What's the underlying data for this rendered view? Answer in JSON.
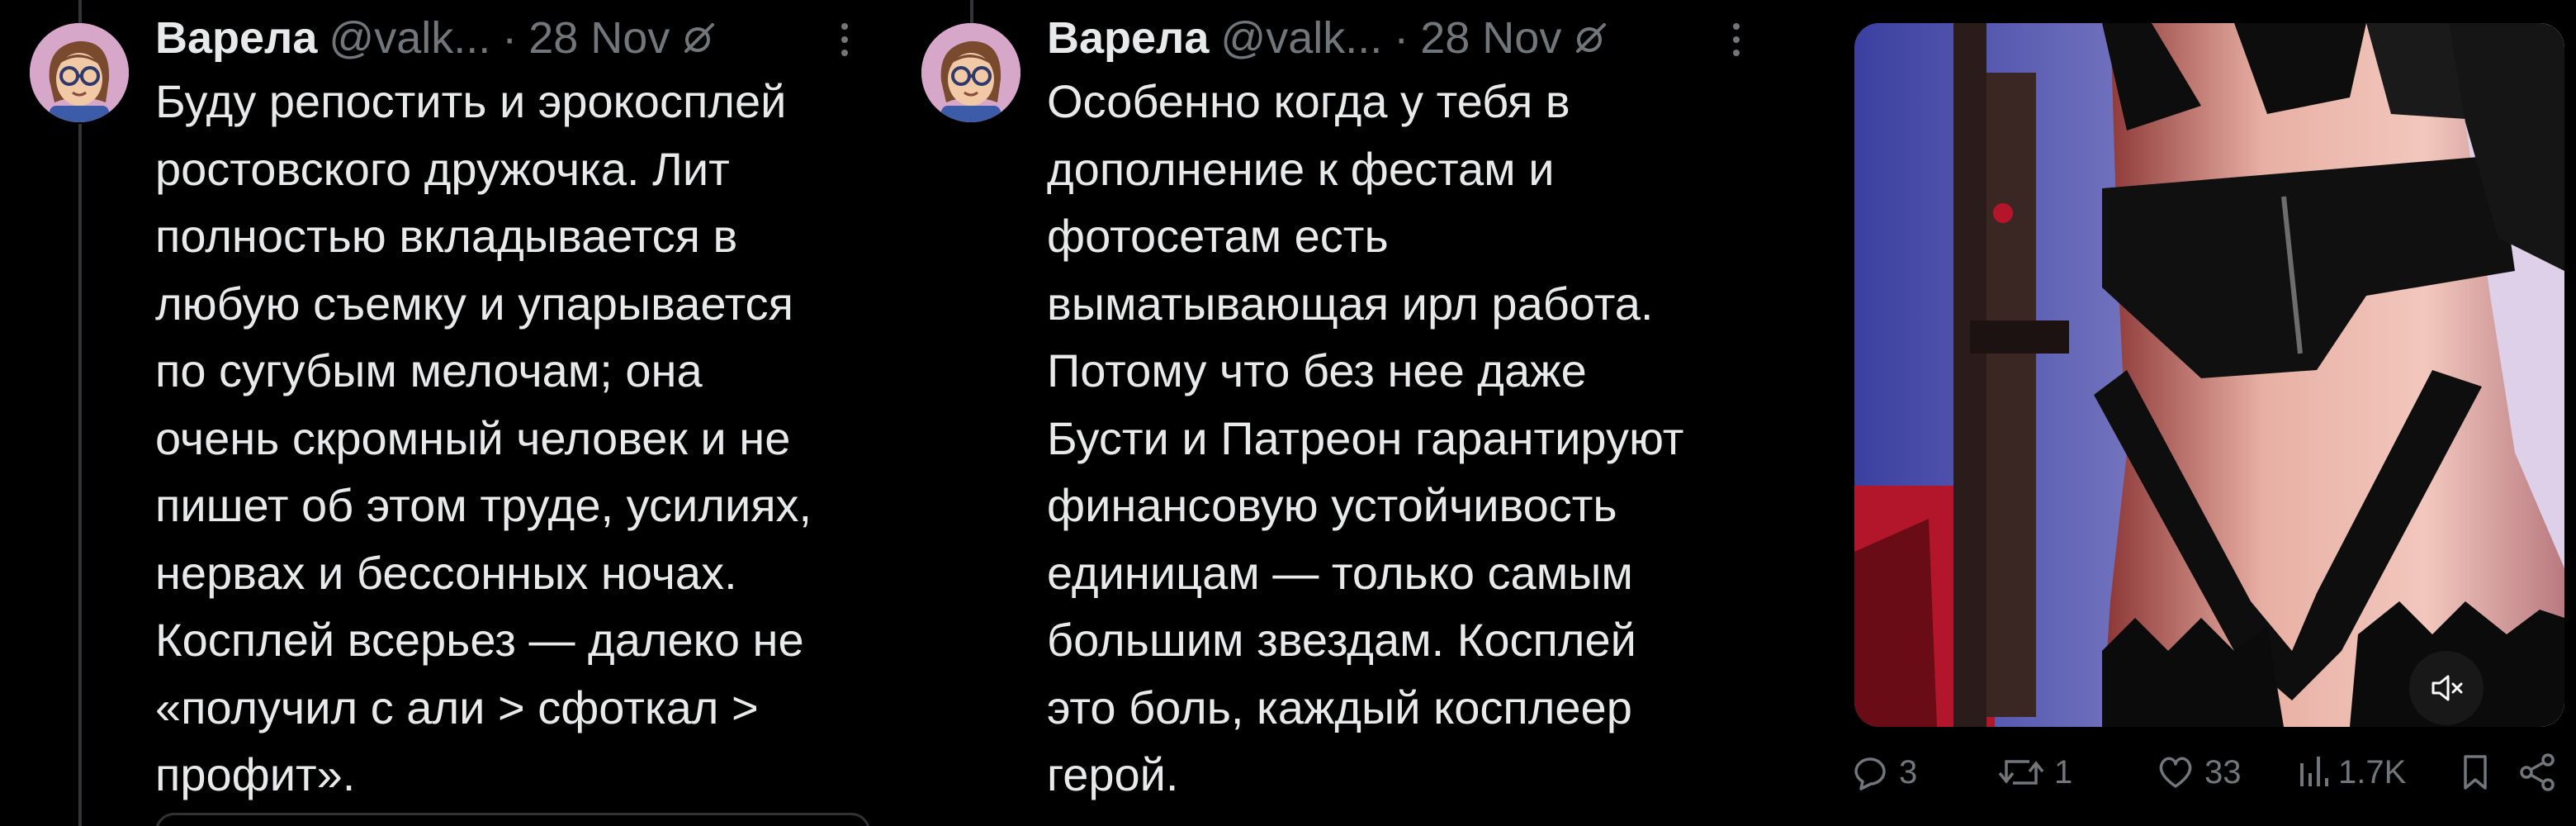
{
  "colors": {
    "background": "#000000",
    "text": "#e7e9ea",
    "muted": "#71767b",
    "line": "#333639",
    "avatar_bg": "#d7a7c9"
  },
  "tweets": [
    {
      "author_name": "Варела",
      "author_handle": "@valk...",
      "separator": "·",
      "date": "28 Nov",
      "text_lines": [
        "Буду репостить и эрокосплей",
        "ростовского дружочка. Лит",
        "полностью вкладывается в",
        "любую съемку и упарывается",
        "по сугубым мелочам; она",
        "очень скромный человек и не",
        "пишет об этом труде, усилиях,",
        "нервах и бессонных ночах.",
        "Косплей всерьез — далеко не",
        "«получил с али > сфоткал >",
        "профит»."
      ],
      "icons": {
        "avatar": "avatar-cartoon-glasses",
        "grok": "grok-icon",
        "more": "more-vertical-icon"
      }
    },
    {
      "author_name": "Варела",
      "author_handle": "@valk...",
      "separator": "·",
      "date": "28 Nov",
      "text_lines": [
        "Особенно когда у тебя в",
        "дополнение к фестам и",
        "фотосетам есть",
        "выматывающая ирл работа.",
        "Потому что без нее даже",
        "Бусти и Патреон гарантируют",
        "финансовую устойчивость",
        "единицам — только самым",
        "большим звездам. Косплей",
        "это боль, каждый косплеер",
        "герой."
      ],
      "icons": {
        "avatar": "avatar-cartoon-glasses",
        "grok": "grok-icon",
        "more": "more-vertical-icon"
      }
    }
  ],
  "media": {
    "type": "video",
    "content": "cosplay-photo-black-latex-outfit",
    "mute_icon": "volume-muted-icon"
  },
  "actions": [
    {
      "name": "reply",
      "icon": "reply-icon",
      "count": "3"
    },
    {
      "name": "repost",
      "icon": "repost-icon",
      "count": "1"
    },
    {
      "name": "like",
      "icon": "heart-icon",
      "count": "33"
    },
    {
      "name": "views",
      "icon": "views-icon",
      "count": "1.7K"
    },
    {
      "name": "bookmark",
      "icon": "bookmark-icon",
      "count": ""
    },
    {
      "name": "share",
      "icon": "share-icon",
      "count": ""
    }
  ]
}
